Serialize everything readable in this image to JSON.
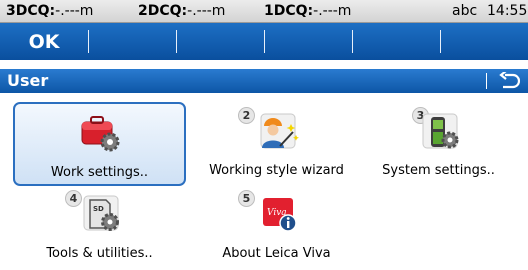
{
  "status_bar": {
    "dcq3_label": "3DCQ:",
    "dcq3_value": "-.---m",
    "dcq2_label": "2DCQ:",
    "dcq2_value": "-.---m",
    "dcq1_label": "1DCQ:",
    "dcq1_value": "-.---m",
    "input_mode": "abc",
    "time": "14:55"
  },
  "softkeys": [
    "OK",
    "",
    "",
    "",
    "",
    ""
  ],
  "header": {
    "title": "User",
    "back_icon": "return-arrow-icon"
  },
  "menu_items": [
    {
      "number": "",
      "label": "Work settings..",
      "icon": "red-case-gear-icon",
      "selected": true
    },
    {
      "number": "2",
      "label": "Working style wizard",
      "icon": "worker-wand-icon",
      "selected": false
    },
    {
      "number": "3",
      "label": "System settings..",
      "icon": "controller-gear-icon",
      "selected": false
    },
    {
      "number": "4",
      "label": "Tools & utilities..",
      "icon": "sd-card-gear-icon",
      "selected": false
    },
    {
      "number": "5",
      "label": "About Leica Viva",
      "icon": "viva-info-icon",
      "selected": false
    }
  ],
  "colors": {
    "accent_blue": "#0d56a6",
    "selection_border": "#2b6fc0"
  }
}
